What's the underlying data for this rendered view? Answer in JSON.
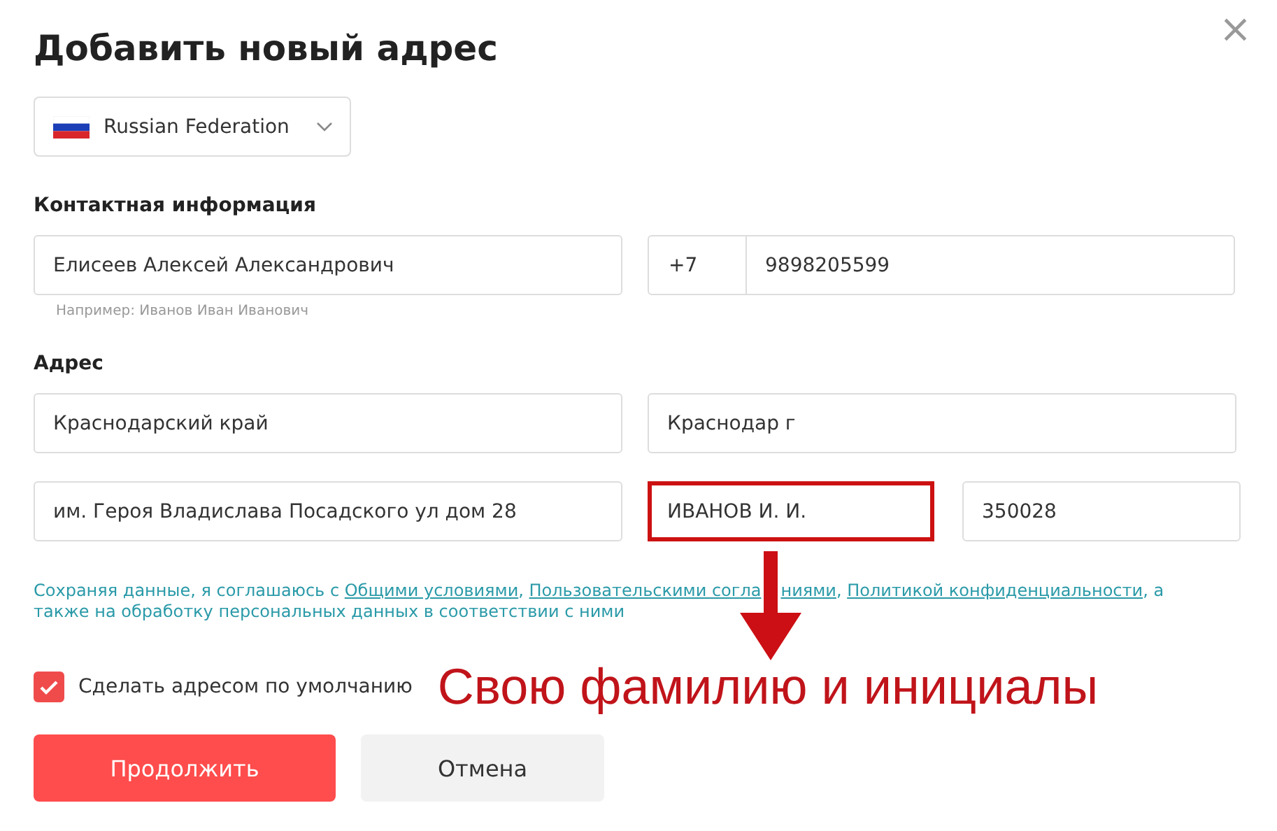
{
  "dialog": {
    "title": "Добавить новый адрес",
    "close": "×"
  },
  "country": {
    "value": "Russian Federation"
  },
  "contact": {
    "heading": "Контактная информация",
    "name": {
      "value": "Елисеев Алексей Александрович",
      "hint": "Например: Иванов Иван Иванович"
    },
    "phone": {
      "prefix": "+7",
      "value": "9898205599"
    }
  },
  "address": {
    "heading": "Адрес",
    "rows": [
      [
        {
          "value": "Краснодарский край",
          "highlighted": false
        },
        {
          "value": "Краснодар г",
          "highlighted": false
        }
      ],
      [
        {
          "value": "им. Героя Владислава Посадского ул дом 28",
          "highlighted": false
        },
        {
          "value": "ИВАНОВ И. И.",
          "highlighted": true
        },
        {
          "value": "350028",
          "highlighted": false
        }
      ]
    ]
  },
  "agreement": {
    "parts": [
      {
        "kind": "text",
        "text": "Сохраняя данные, я соглашаюсь с "
      },
      {
        "kind": "link",
        "text": "Общими условиями"
      },
      {
        "kind": "text",
        "text": ", "
      },
      {
        "kind": "link",
        "text": "Пользовательскими согла"
      },
      {
        "kind": "covered"
      },
      {
        "kind": "link",
        "text": "ниями"
      },
      {
        "kind": "text",
        "text": ", "
      },
      {
        "kind": "link",
        "text": "Политикой конфиденциальности"
      },
      {
        "kind": "text",
        "text": ", а также на обработку персональных данных в соответствии с ними"
      }
    ]
  },
  "default_address": {
    "label": "Сделать адресом по умолчанию",
    "checked": true
  },
  "annotation": {
    "text": "Свою фамилию и инициалы"
  },
  "buttons": [
    {
      "kind": "primary",
      "label": "Продолжить"
    },
    {
      "kind": "secondary",
      "label": "Отмена"
    }
  ]
}
